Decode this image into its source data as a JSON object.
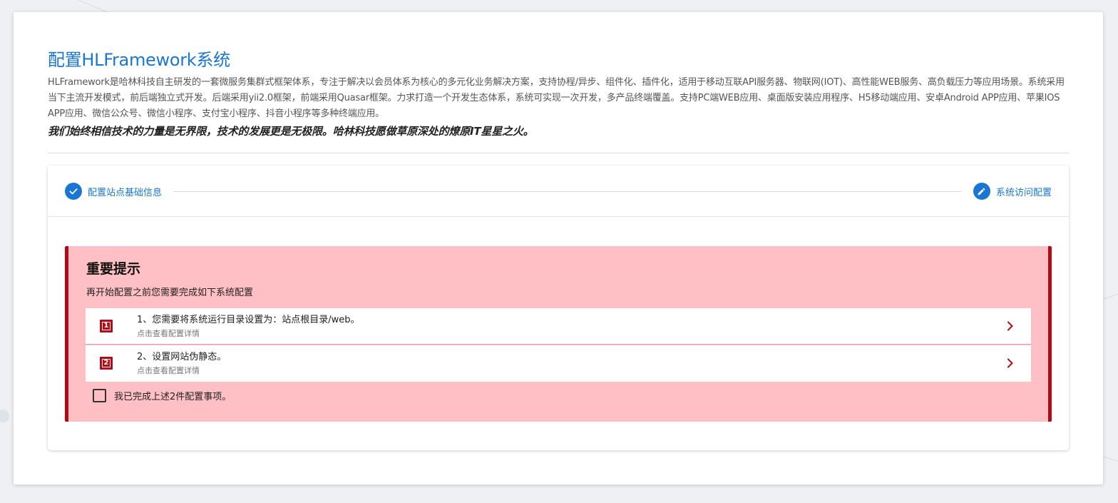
{
  "header": {
    "title": "配置HLFramework系统",
    "description": "HLFramework是哈林科技自主研发的一套微服务集群式框架体系，专注于解决以会员体系为核心的多元化业务解决方案，支持协程/异步、组件化、插件化，适用于移动互联API服务器、物联网(IOT)、高性能WEB服务、高负载压力等应用场景。系统采用当下主流开发模式，前后端独立式开发。后端采用yii2.0框架，前端采用Quasar框架。力求打造一个开发生态体系，系统可实现一次开发，多产品终端覆盖。支持PC端WEB应用、桌面版安装应用程序、H5移动端应用、安卓Android APP应用、苹果IOS APP应用、微信公众号、微信小程序、支付宝小程序、抖音小程序等多种终端应用。",
    "slogan": "我们始终相信技术的力量是无界限，技术的发展更是无极限。哈林科技愿做草原深处的燎原IT星星之火。"
  },
  "stepper": {
    "steps": [
      {
        "label": "配置站点基础信息",
        "icon": "check-icon",
        "state": "done"
      },
      {
        "label": "系统访问配置",
        "icon": "pencil-icon",
        "state": "active"
      }
    ]
  },
  "notice": {
    "title": "重要提示",
    "subtitle": "再开始配置之前您需要完成如下系统配置",
    "items": [
      {
        "number": "1",
        "title": "1、您需要将系统运行目录设置为：站点根目录/web。",
        "caption": "点击查看配置详情"
      },
      {
        "number": "2",
        "title": "2、设置网站伪静态。",
        "caption": "点击查看配置详情"
      }
    ],
    "confirm_label": "我已完成上述2件配置事项。",
    "confirm_checked": false
  },
  "colors": {
    "primary": "#1976d2",
    "notice_bg": "#ffc0c5",
    "notice_accent": "#b20b16"
  }
}
